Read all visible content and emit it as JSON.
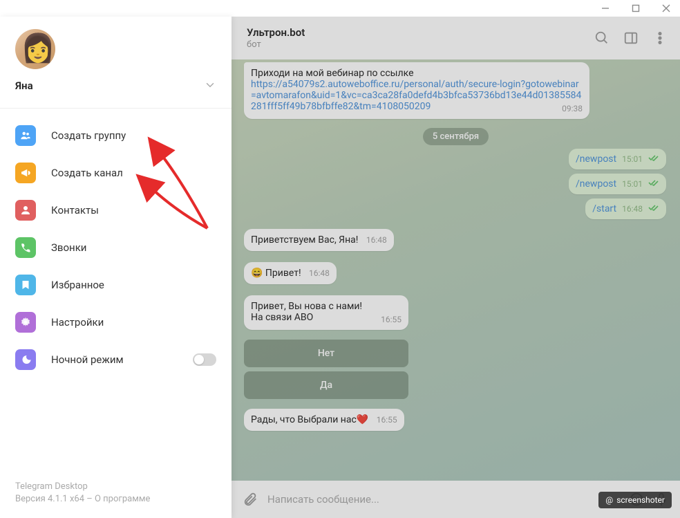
{
  "window": {
    "minimize": "—",
    "maximize": "☐",
    "close": "✕"
  },
  "profile": {
    "name": "Яна",
    "sub": " "
  },
  "menu": {
    "items": [
      {
        "label": "Создать группу"
      },
      {
        "label": "Создать канал"
      },
      {
        "label": "Контакты"
      },
      {
        "label": "Звонки"
      },
      {
        "label": "Избранное"
      },
      {
        "label": "Настройки"
      },
      {
        "label": "Ночной режим"
      }
    ],
    "footer_app": "Telegram Desktop",
    "footer_ver": "Версия 4.1.1 x64 – О программе"
  },
  "chat": {
    "title": "Ультрон.bot",
    "sub": "бот",
    "msg1_text": "Приходи на мой вебинар по ссылке",
    "msg1_link": "https://a54079s2.autoweboffice.ru/personal/auth/secure-login?gotowebinar=avtomarafon&uid=1&vc=ca3ca28fa0defd4b3bfca53736bd13e44d01385584281fff5ff49b78bfbffe82&tm=4108050209",
    "msg1_time": "09:38",
    "date1": "5 сентября",
    "out1": "/newpost",
    "out1_time": "15:01",
    "out2": "/newpost",
    "out2_time": "15:01",
    "out3": "/start",
    "out3_time": "16:48",
    "in2": "Приветствуем Вас, Яна!",
    "in2_time": "16:48",
    "in3": "Привет!",
    "in3_time": "16:48",
    "in4a": "Привет, Вы нова с нами!",
    "in4b": "На связи АВО",
    "in4_time": "16:55",
    "btn1": "Нет",
    "btn2": "Да",
    "in5": "Рады, что Выбрали нас",
    "in5_time": "16:55",
    "composer_placeholder": "Написать сообщение..."
  },
  "watermark": "screenshoter"
}
